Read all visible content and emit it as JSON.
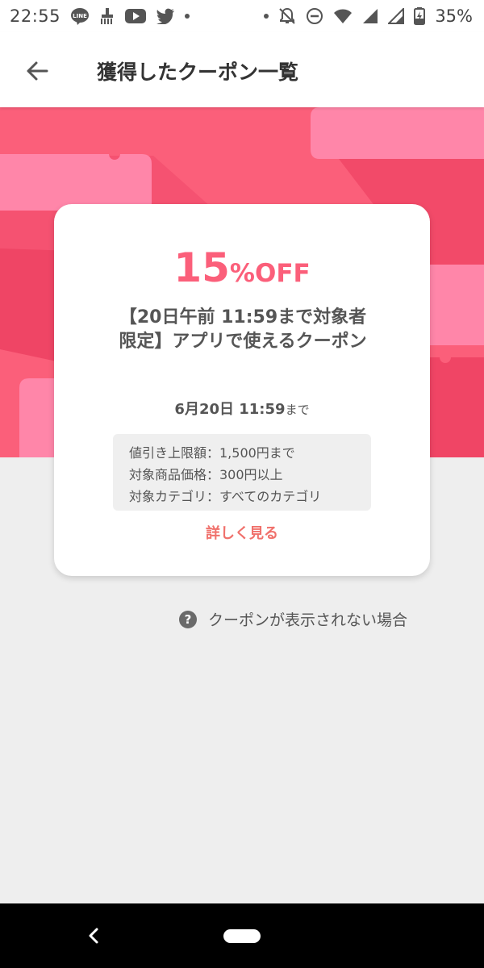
{
  "status_bar": {
    "time": "22:55",
    "battery": "35%",
    "left_icons": [
      "line-icon",
      "brush-icon",
      "youtube-icon",
      "twitter-icon"
    ],
    "right_icons": [
      "notifications-off-icon",
      "do-not-disturb-icon",
      "wifi-icon",
      "signal-icon",
      "signal-icon",
      "battery-icon"
    ]
  },
  "header": {
    "title": "獲得したクーポン一覧"
  },
  "coupon": {
    "discount_value": "15",
    "discount_unit": "%OFF",
    "name": "【20日午前 11:59まで対象者限定】アプリで使えるクーポン",
    "expiry_date": "6月20日 11:59",
    "expiry_suffix": "まで",
    "conditions": [
      "値引き上限額：1,500円まで",
      "対象商品価格：300円以上",
      "対象カテゴリ：すべてのカテゴリ"
    ],
    "detail_link": "詳しく見る"
  },
  "help": {
    "label": "クーポンが表示されない場合"
  },
  "colors": {
    "accent": "#fb5f7a",
    "hero_light": "#ff86a9",
    "hero_dark": "#ef4565",
    "link": "#f0716c"
  }
}
